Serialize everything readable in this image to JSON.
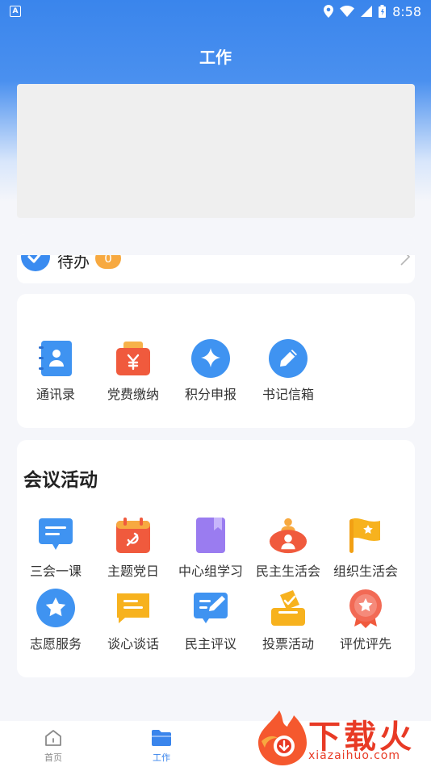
{
  "status_bar": {
    "app_icon_letter": "A",
    "time": "8:58"
  },
  "header": {
    "title": "工作"
  },
  "todo": {
    "label": "待办",
    "count": "0"
  },
  "tools": [
    {
      "label": "通讯录",
      "icon": "contacts-book-icon"
    },
    {
      "label": "党费缴纳",
      "icon": "party-fee-wallet-icon"
    },
    {
      "label": "积分申报",
      "icon": "points-star-icon"
    },
    {
      "label": "书记信箱",
      "icon": "pencil-mailbox-icon"
    }
  ],
  "meetings": {
    "title": "会议活动",
    "items": [
      {
        "label": "三会一课",
        "icon": "chat-board-icon"
      },
      {
        "label": "主题党日",
        "icon": "party-calendar-icon"
      },
      {
        "label": "中心组学习",
        "icon": "book-icon"
      },
      {
        "label": "民主生活会",
        "icon": "meeting-person-icon"
      },
      {
        "label": "组织生活会",
        "icon": "flag-icon"
      },
      {
        "label": "志愿服务",
        "icon": "star-badge-icon"
      },
      {
        "label": "谈心谈话",
        "icon": "message-icon"
      },
      {
        "label": "民主评议",
        "icon": "review-edit-icon"
      },
      {
        "label": "投票活动",
        "icon": "ballot-box-icon"
      },
      {
        "label": "评优评先",
        "icon": "medal-icon"
      }
    ]
  },
  "tabbar": {
    "tabs": [
      {
        "label": "首页",
        "active": false
      },
      {
        "label": "工作",
        "active": true
      }
    ]
  },
  "watermark": {
    "text": "下载火",
    "url": "xiazaihuo.com"
  },
  "colors": {
    "primary": "#3a85ec",
    "badge": "#f7a940",
    "watermark": "#e83a25"
  }
}
